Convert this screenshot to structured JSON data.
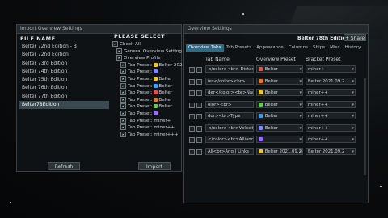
{
  "import_window": {
    "title": "Import Overview Settings",
    "file_header": "FILE NAME",
    "select_header": "PLEASE SELECT",
    "files": [
      "Belter 72nd Edition - B",
      "Belter 72nd Edition",
      "Belter 73rd Edition",
      "Belter 74th Edition",
      "Belter 75th Edition",
      "Belter 76th Edition",
      "Belter 77th Edition",
      "Belter78Edition"
    ],
    "selected_file": "Belter78Edition",
    "options": [
      {
        "label": "Check All",
        "indent": 0,
        "icon": ""
      },
      {
        "label": "General Overview Settings",
        "indent": 1,
        "icon": ""
      },
      {
        "label": "Overview Profile",
        "indent": 1,
        "icon": ""
      },
      {
        "label": "Tab Preset:",
        "suffix": "Belter 2021",
        "indent": 2,
        "icon": "#f3c623"
      },
      {
        "label": "Tab Preset:",
        "suffix": "",
        "indent": 2,
        "icon": "#7b8bff"
      },
      {
        "label": "Tab Preset:",
        "suffix": "Belter",
        "indent": 2,
        "icon": "#f3c623"
      },
      {
        "label": "Tab Preset:",
        "suffix": "Belter",
        "indent": 2,
        "icon": "#3aa0ff"
      },
      {
        "label": "Tab Preset:",
        "suffix": "Belter",
        "indent": 2,
        "icon": "#e0524a"
      },
      {
        "label": "Tab Preset:",
        "suffix": "Belter",
        "indent": 2,
        "icon": "#e07a2a"
      },
      {
        "label": "Tab Preset:",
        "suffix": "Belter",
        "indent": 2,
        "icon": "#5bd04c"
      },
      {
        "label": "Tab Preset:",
        "suffix": "",
        "indent": 2,
        "icon": "#9c6cff"
      },
      {
        "label": "Tab Preset:",
        "suffix": "miner+",
        "indent": 2,
        "icon": ""
      },
      {
        "label": "Tab Preset:",
        "suffix": "miner++",
        "indent": 2,
        "icon": ""
      },
      {
        "label": "Tab Preset:",
        "suffix": "miner+++",
        "indent": 2,
        "icon": ""
      }
    ],
    "refresh_label": "Refresh",
    "import_label": "Import"
  },
  "overview_window": {
    "title": "Overview Settings",
    "profile_name": "Belter 78th Edition",
    "share_label": "Share",
    "tabs": [
      "Overview Tabs",
      "Tab Presets",
      "Appearance",
      "Columns",
      "Ships",
      "Misc",
      "History"
    ],
    "active_tab": "Overview Tabs",
    "headers": {
      "tab_name": "Tab Name",
      "overview_preset": "Overview Preset",
      "bracket_preset": "Bracket Preset"
    },
    "rows": [
      {
        "tab_name": "</color><br> Distance",
        "preset": "Belter",
        "preset_color": "#e0524a",
        "bracket": "miner+"
      },
      {
        "tab_name": "ies</color><br>",
        "preset": "Belter",
        "preset_color": "#e07a2a",
        "bracket": "Belter 2021.09.2"
      },
      {
        "tab_name": "der</color><br>Name",
        "preset": "Belter",
        "preset_color": "#f3c623",
        "bracket": "miner++"
      },
      {
        "tab_name": "olor><br>",
        "preset": "Belter",
        "preset_color": "#5bd04c",
        "bracket": "miner++"
      },
      {
        "tab_name": "dor><br>Type",
        "preset": "Belter",
        "preset_color": "#3aa0ff",
        "bracket": "miner++"
      },
      {
        "tab_name": "</color><br>Velocity |",
        "preset": "Belter",
        "preset_color": "#7b8bff",
        "bracket": "miner++"
      },
      {
        "tab_name": "</color><br>Alliance |",
        "preset": "",
        "preset_color": "#9c6cff",
        "bracket": "miner++"
      },
      {
        "tab_name": "All<br>Ang | Links",
        "preset": "Belter 2021.09.2",
        "preset_color": "#f3c623",
        "bracket": "Belter 2021.09.2"
      }
    ]
  }
}
